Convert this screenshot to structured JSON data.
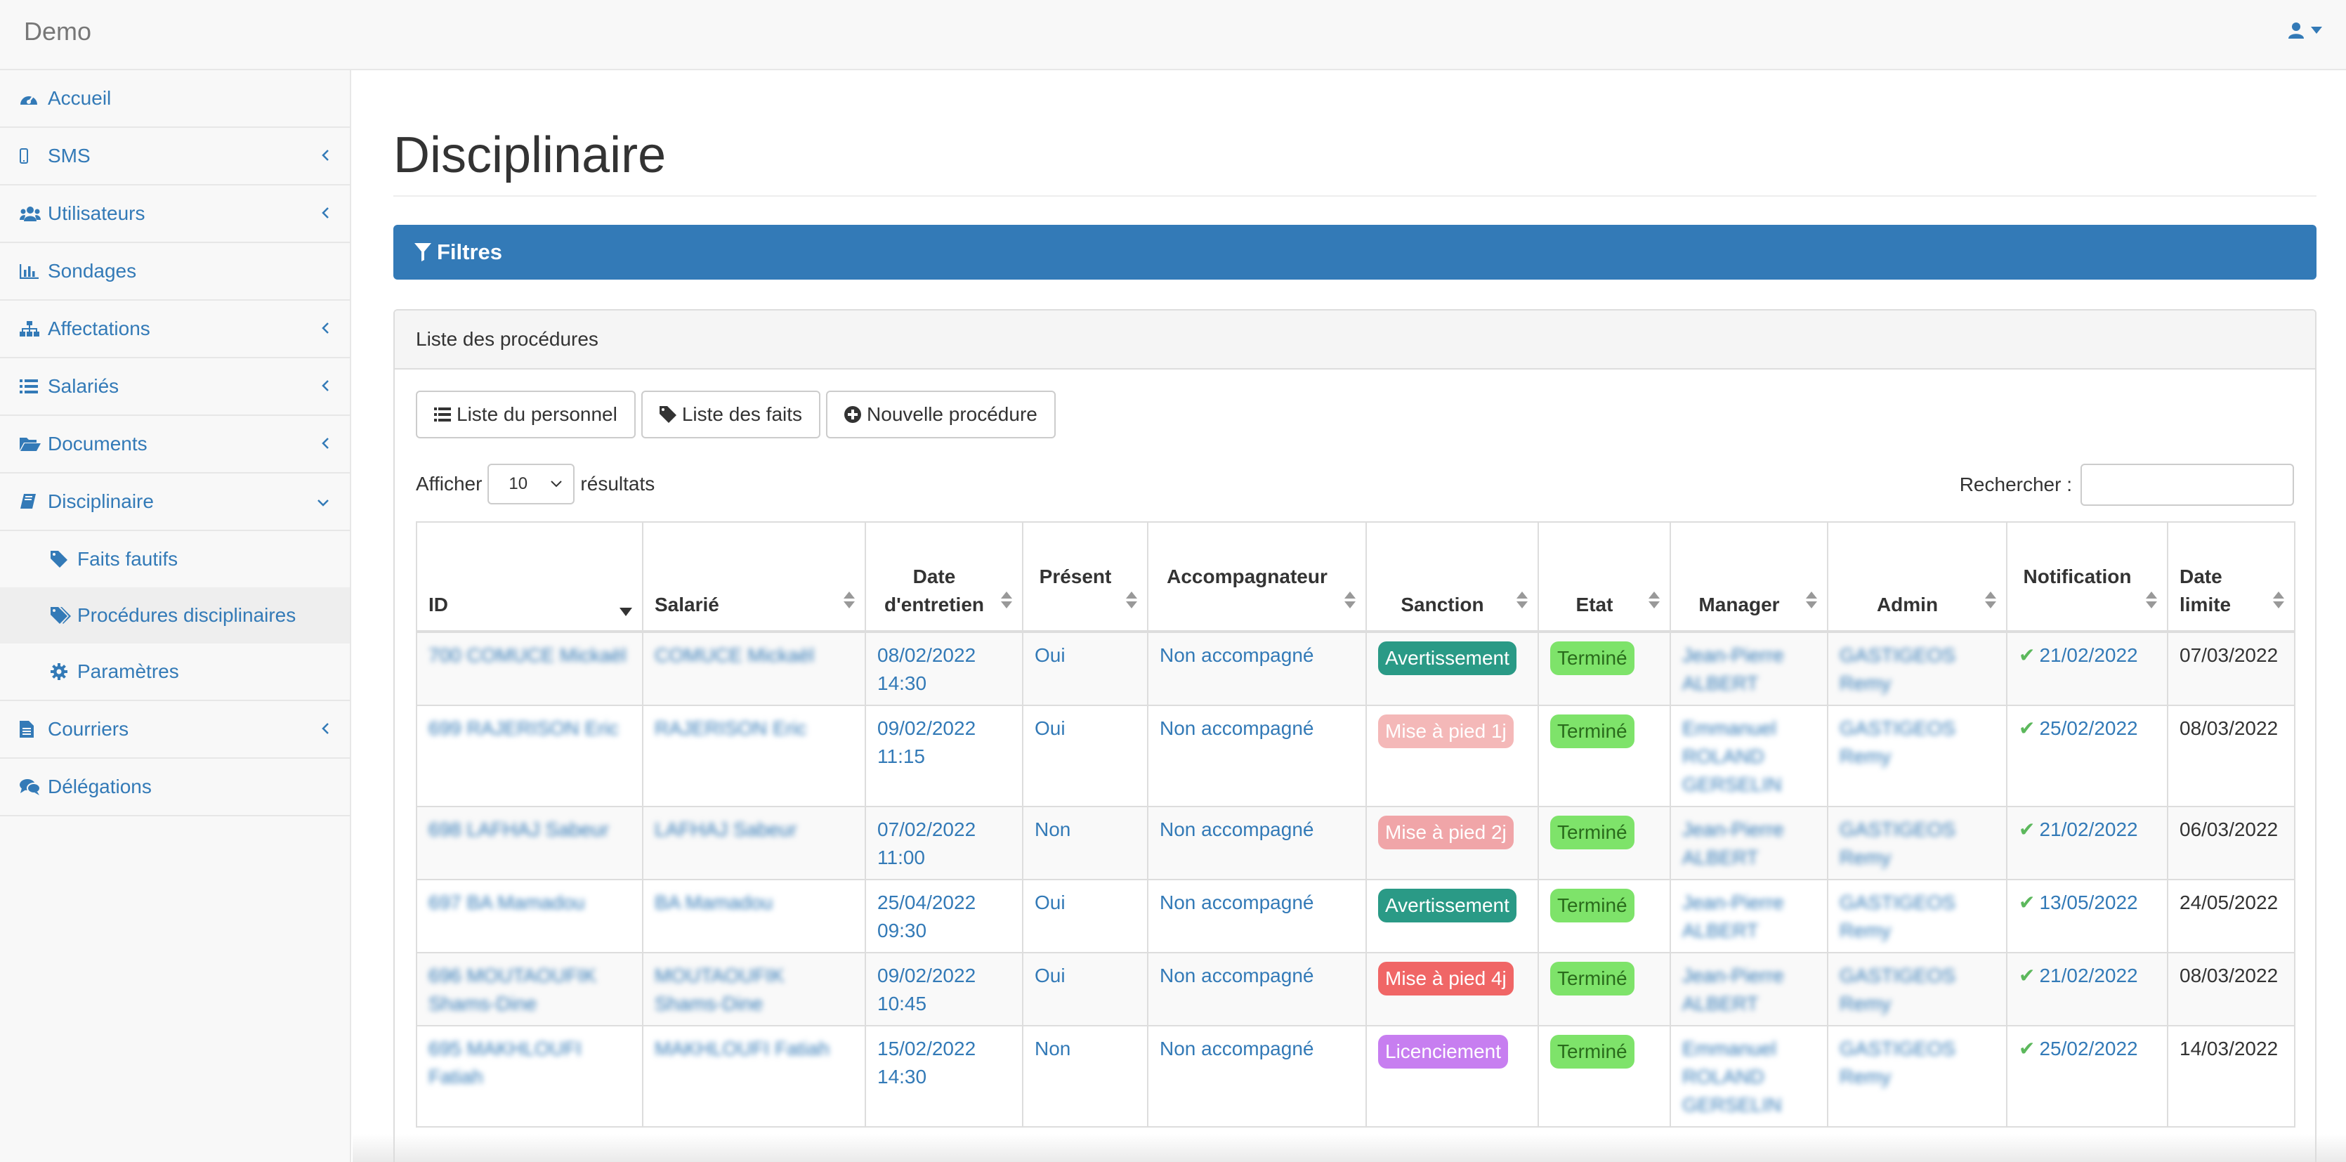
{
  "app": {
    "brand": "Demo"
  },
  "sidebar": {
    "items": [
      {
        "label": "Accueil",
        "icon": "dashboard-icon",
        "chevron": false
      },
      {
        "label": "SMS",
        "icon": "mobile-icon",
        "chevron": true
      },
      {
        "label": "Utilisateurs",
        "icon": "users-icon",
        "chevron": true
      },
      {
        "label": "Sondages",
        "icon": "bar-chart-icon",
        "chevron": false
      },
      {
        "label": "Affectations",
        "icon": "sitemap-icon",
        "chevron": true
      },
      {
        "label": "Salariés",
        "icon": "list-icon",
        "chevron": true
      },
      {
        "label": "Documents",
        "icon": "folder-open-icon",
        "chevron": true
      },
      {
        "label": "Disciplinaire",
        "icon": "book-icon",
        "chevron": true,
        "expanded": true
      }
    ],
    "subitems": [
      {
        "label": "Faits fautifs",
        "icon": "tag-icon"
      },
      {
        "label": "Procédures disciplinaires",
        "icon": "tags-icon",
        "active": true
      },
      {
        "label": "Paramètres",
        "icon": "gear-icon"
      }
    ],
    "items_after": [
      {
        "label": "Courriers",
        "icon": "file-text-icon",
        "chevron": true
      },
      {
        "label": "Délégations",
        "icon": "comments-icon",
        "chevron": false
      }
    ]
  },
  "main": {
    "title": "Disciplinaire",
    "filters_label": "Filtres",
    "panel_heading": "Liste des procédures",
    "buttons": {
      "personnel": "Liste du personnel",
      "faits": "Liste des faits",
      "nouvelle": "Nouvelle procédure"
    },
    "length": {
      "prefix": "Afficher",
      "value": "10",
      "suffix": "résultats"
    },
    "search_label": "Rechercher :"
  },
  "table": {
    "headers": {
      "id": "ID",
      "salarie": "Salarié",
      "date_entretien": "Date d'entretien",
      "present": "Présent",
      "accompagnateur": "Accompagnateur",
      "sanction": "Sanction",
      "etat": "Etat",
      "manager": "Manager",
      "admin": "Admin",
      "notification": "Notification",
      "date_limite": "Date limite"
    },
    "rows": [
      {
        "id": "700 COMUCE Mickaël",
        "salarie": "COMUCE Mickaël",
        "date": "08/02/2022",
        "time": "14:30",
        "present": "Oui",
        "accomp": "Non accompagné",
        "sanction": "Avertissement",
        "sanction_class": "b-avert",
        "etat": "Terminé",
        "manager": "Jean-Pierre ALBERT",
        "admin": "GASTIGEOS Remy",
        "notif": "21/02/2022",
        "limite": "07/03/2022"
      },
      {
        "id": "699 RAJERISON Eric",
        "salarie": "RAJERISON Eric",
        "date": "09/02/2022",
        "time": "11:15",
        "present": "Oui",
        "accomp": "Non accompagné",
        "sanction": "Mise à pied 1j",
        "sanction_class": "b-mise1",
        "etat": "Terminé",
        "manager": "Emmanuel ROLAND GERSELIN",
        "admin": "GASTIGEOS Remy",
        "notif": "25/02/2022",
        "limite": "08/03/2022"
      },
      {
        "id": "698 LAFHAJ Sabeur",
        "salarie": "LAFHAJ Sabeur",
        "date": "07/02/2022",
        "time": "11:00",
        "present": "Non",
        "accomp": "Non accompagné",
        "sanction": "Mise à pied 2j",
        "sanction_class": "b-mise2",
        "etat": "Terminé",
        "manager": "Jean-Pierre ALBERT",
        "admin": "GASTIGEOS Remy",
        "notif": "21/02/2022",
        "limite": "06/03/2022"
      },
      {
        "id": "697 BA Mamadou",
        "salarie": "BA Mamadou",
        "date": "25/04/2022",
        "time": "09:30",
        "present": "Oui",
        "accomp": "Non accompagné",
        "sanction": "Avertissement",
        "sanction_class": "b-avert",
        "etat": "Terminé",
        "manager": "Jean-Pierre ALBERT",
        "admin": "GASTIGEOS Remy",
        "notif": "13/05/2022",
        "limite": "24/05/2022"
      },
      {
        "id": "696 MOUTAOUFIK Shams-Dine",
        "salarie": "MOUTAOUFIK Shams-Dine",
        "date": "09/02/2022",
        "time": "10:45",
        "present": "Oui",
        "accomp": "Non accompagné",
        "sanction": "Mise à pied 4j",
        "sanction_class": "b-mise4",
        "etat": "Terminé",
        "manager": "Jean-Pierre ALBERT",
        "admin": "GASTIGEOS Remy",
        "notif": "21/02/2022",
        "limite": "08/03/2022"
      },
      {
        "id": "695 MAKHLOUFI Fatiah",
        "salarie": "MAKHLOUFI Fatiah",
        "date": "15/02/2022",
        "time": "14:30",
        "present": "Non",
        "accomp": "Non accompagné",
        "sanction": "Licenciement",
        "sanction_class": "b-licen",
        "etat": "Terminé",
        "manager": "Emmanuel ROLAND GERSELIN",
        "admin": "GASTIGEOS Remy",
        "notif": "25/02/2022",
        "limite": "14/03/2022"
      }
    ]
  },
  "colors": {
    "primary": "#337ab7",
    "success": "#5cb85c",
    "badge_termine": "#7ee36a"
  }
}
